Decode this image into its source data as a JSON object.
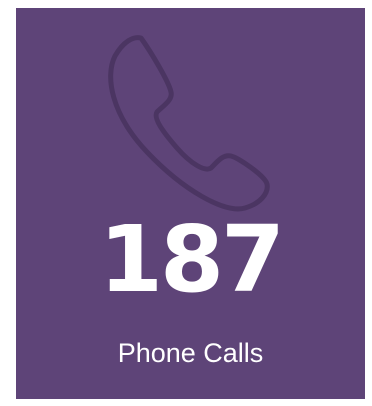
{
  "stat_card": {
    "icon": "phone-handset-icon",
    "value": "187",
    "label": "Phone Calls",
    "colors": {
      "background": "#5e4478",
      "icon_stroke": "#4b3562",
      "text": "#ffffff"
    }
  }
}
